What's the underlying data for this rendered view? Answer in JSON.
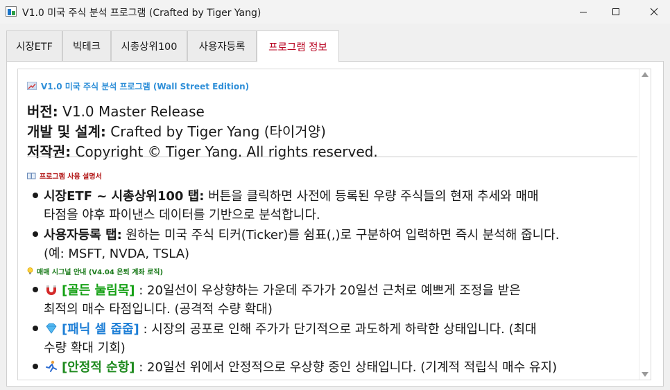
{
  "window": {
    "title": "V1.0 미국 주식 분석 프로그램 (Crafted by Tiger Yang)"
  },
  "tabs": [
    {
      "label": "시장ETF"
    },
    {
      "label": "빅테크"
    },
    {
      "label": "시총상위100"
    },
    {
      "label": "사용자등록"
    },
    {
      "label": "프로그램 정보",
      "active": true
    }
  ],
  "info": {
    "header": "V1.0 미국 주식 분석 프로그램 (Wall Street Edition)",
    "version_label": "버전:",
    "version_value": " V1.0 Master Release",
    "dev_label": "개발 및 설계:",
    "dev_value": " Crafted by Tiger Yang (타이거양)",
    "copy_label": "저작권:",
    "copy_value": " Copyright © Tiger Yang. All rights reserved."
  },
  "manual": {
    "title": "프로그램 사용 설명서",
    "b1_label": "시장ETF ~ 시총상위100 탭:",
    "b1_text1": " 버튼을 클릭하면 사전에 등록된 우량 주식들의 현재 추세와 매매",
    "b1_text2": "타점을 야후 파이낸스 데이터를 기반으로 분석합니다.",
    "b2_label": "사용자등록 탭:",
    "b2_text1": " 원하는 미국 주식 티커(Ticker)를 쉼표(,)로 구분하여 입력하면 즉시 분석해 줍니다.",
    "b2_text2": "(예: MSFT, NVDA, TSLA)"
  },
  "signals": {
    "title": "매매 시그널 안내 (V4.04 은퇴 계좌 로직)",
    "s1_tag": "[골든 눌림목]",
    "s1_text1": " : 20일선이 우상향하는 가운데 주가가 20일선 근처로 예쁘게 조정을 받은",
    "s1_text2": "최적의 매수 타점입니다. (공격적 수량 확대)",
    "s2_tag": "[패닉 셀 줍줍]",
    "s2_text1": " : 시장의 공포로 인해 주가가 단기적으로 과도하게 하락한 상태입니다. (최대",
    "s2_text2": "수량 확대 기회)",
    "s3_tag": "[안정적 순항]",
    "s3_text1": " : 20일선 위에서 안정적으로 우상향 중인 상태입니다. (기계적 적립식 매수 유지)"
  },
  "icons": {
    "app": "chart-app-icon",
    "header": "chart-emoji-icon",
    "manual": "book-icon",
    "signals": "lightbulb-icon",
    "s1": "magnet-icon",
    "s2": "gem-icon",
    "s3": "runner-icon"
  },
  "colors": {
    "active_tab_text": "#b8001f",
    "header_blue": "#2f8fd8",
    "manual_red": "#b01010",
    "signals_green": "#1a7a1a",
    "golden": "#14a014",
    "panic": "#1e7fd6",
    "stable": "#1e8a1e"
  }
}
